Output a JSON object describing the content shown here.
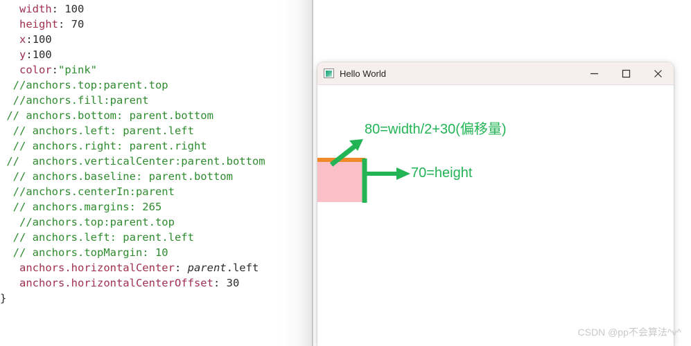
{
  "code_pane": {
    "lines": [
      {
        "indent": 3,
        "tokens": [
          {
            "t": "prop",
            "v": "width"
          },
          {
            "t": "punct",
            "v": ": "
          },
          {
            "t": "num",
            "v": "100"
          }
        ]
      },
      {
        "indent": 3,
        "tokens": [
          {
            "t": "prop",
            "v": "height"
          },
          {
            "t": "punct",
            "v": ": "
          },
          {
            "t": "num",
            "v": "70"
          }
        ]
      },
      {
        "indent": 3,
        "tokens": [
          {
            "t": "prop",
            "v": "x"
          },
          {
            "t": "punct",
            "v": ":"
          },
          {
            "t": "num",
            "v": "100"
          }
        ]
      },
      {
        "indent": 3,
        "tokens": [
          {
            "t": "prop",
            "v": "y"
          },
          {
            "t": "punct",
            "v": ":"
          },
          {
            "t": "num",
            "v": "100"
          }
        ]
      },
      {
        "indent": 3,
        "tokens": [
          {
            "t": "prop",
            "v": "color"
          },
          {
            "t": "punct",
            "v": ":"
          },
          {
            "t": "str",
            "v": "\"pink\""
          }
        ]
      },
      {
        "indent": 2,
        "tokens": [
          {
            "t": "comment",
            "v": "//anchors.top:parent.top"
          }
        ]
      },
      {
        "indent": 2,
        "tokens": [
          {
            "t": "comment",
            "v": "//anchors.fill:parent"
          }
        ]
      },
      {
        "indent": 1,
        "tokens": [
          {
            "t": "comment",
            "v": "// anchors.bottom: parent.bottom"
          }
        ]
      },
      {
        "indent": 2,
        "tokens": [
          {
            "t": "comment",
            "v": "// anchors.left: parent.left"
          }
        ]
      },
      {
        "indent": 2,
        "tokens": [
          {
            "t": "comment",
            "v": "// anchors.right: parent.right"
          }
        ]
      },
      {
        "indent": 1,
        "tokens": [
          {
            "t": "comment",
            "v": "//  anchors.verticalCenter:parent.bottom"
          }
        ]
      },
      {
        "indent": 2,
        "tokens": [
          {
            "t": "comment",
            "v": "// anchors.baseline: parent.bottom"
          }
        ]
      },
      {
        "indent": 2,
        "tokens": [
          {
            "t": "comment",
            "v": "//anchors.centerIn:parent"
          }
        ]
      },
      {
        "indent": 2,
        "tokens": [
          {
            "t": "comment",
            "v": "// anchors.margins: 265"
          }
        ]
      },
      {
        "indent": 3,
        "tokens": [
          {
            "t": "comment",
            "v": "//anchors.top:parent.top"
          }
        ]
      },
      {
        "indent": 2,
        "tokens": [
          {
            "t": "comment",
            "v": "// anchors.left: parent.left"
          }
        ]
      },
      {
        "indent": 2,
        "tokens": [
          {
            "t": "comment",
            "v": "// anchors.topMargin: 10"
          }
        ]
      },
      {
        "indent": 3,
        "tokens": [
          {
            "t": "prop",
            "v": "anchors.horizontalCenter"
          },
          {
            "t": "punct",
            "v": ": "
          },
          {
            "t": "italic",
            "v": "parent"
          },
          {
            "t": "punct",
            "v": ".left"
          }
        ]
      },
      {
        "indent": 3,
        "tokens": [
          {
            "t": "prop",
            "v": "anchors.horizontalCenterOffset"
          },
          {
            "t": "punct",
            "v": ": "
          },
          {
            "t": "num",
            "v": "30"
          }
        ]
      },
      {
        "indent": 0,
        "tokens": [
          {
            "t": "brace",
            "v": "}"
          }
        ]
      }
    ],
    "colors": {
      "property": "#a03050",
      "comment": "#2e8b2e",
      "string": "#2e8b2e",
      "number": "#2b2b2b"
    }
  },
  "app_window": {
    "title": "Hello World",
    "icon": "app-window-icon",
    "titlebar_color": "#f7eeee",
    "controls": [
      {
        "name": "minimize",
        "glyph": "minimize-icon"
      },
      {
        "name": "maximize",
        "glyph": "maximize-icon"
      },
      {
        "name": "close",
        "glyph": "close-icon"
      }
    ],
    "diagram": {
      "rect": {
        "fill_color": "#fbbfc8",
        "top_border_color": "#f08a28",
        "name": "pink-rectangle"
      },
      "annotation_color": "#22b455",
      "labels": {
        "width_offset": "80=width/2+30(偏移量)",
        "height": "70=height"
      },
      "arrows": [
        {
          "name": "diagonal-offset-arrow",
          "direction": "up-right"
        },
        {
          "name": "height-arrow",
          "direction": "right"
        },
        {
          "name": "height-extent-bar",
          "direction": "vertical"
        }
      ]
    }
  },
  "watermark": {
    "text": "CSDN @pp不会算法^v^"
  }
}
